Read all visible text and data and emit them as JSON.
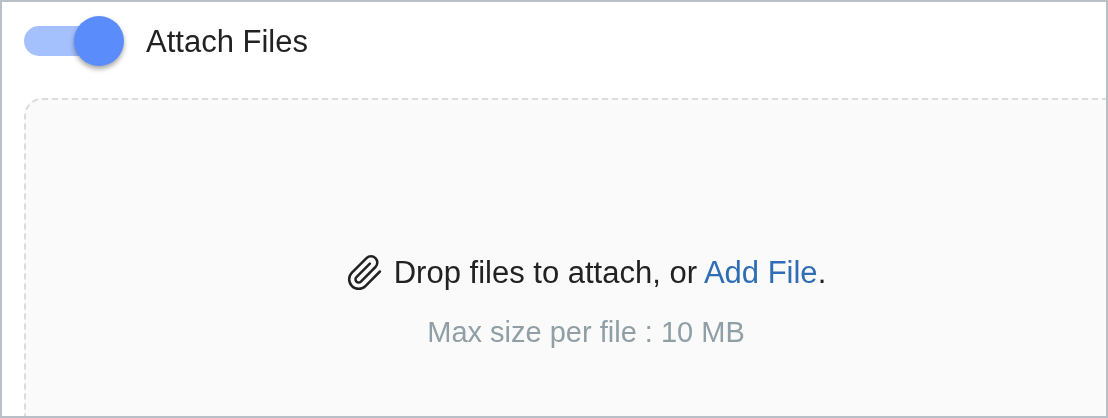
{
  "toggle": {
    "label": "Attach Files",
    "on": true
  },
  "dropzone": {
    "text_before": "Drop files to attach, or ",
    "link": "Add File",
    "text_after": ".",
    "hint": "Max size per file : 10 MB"
  }
}
